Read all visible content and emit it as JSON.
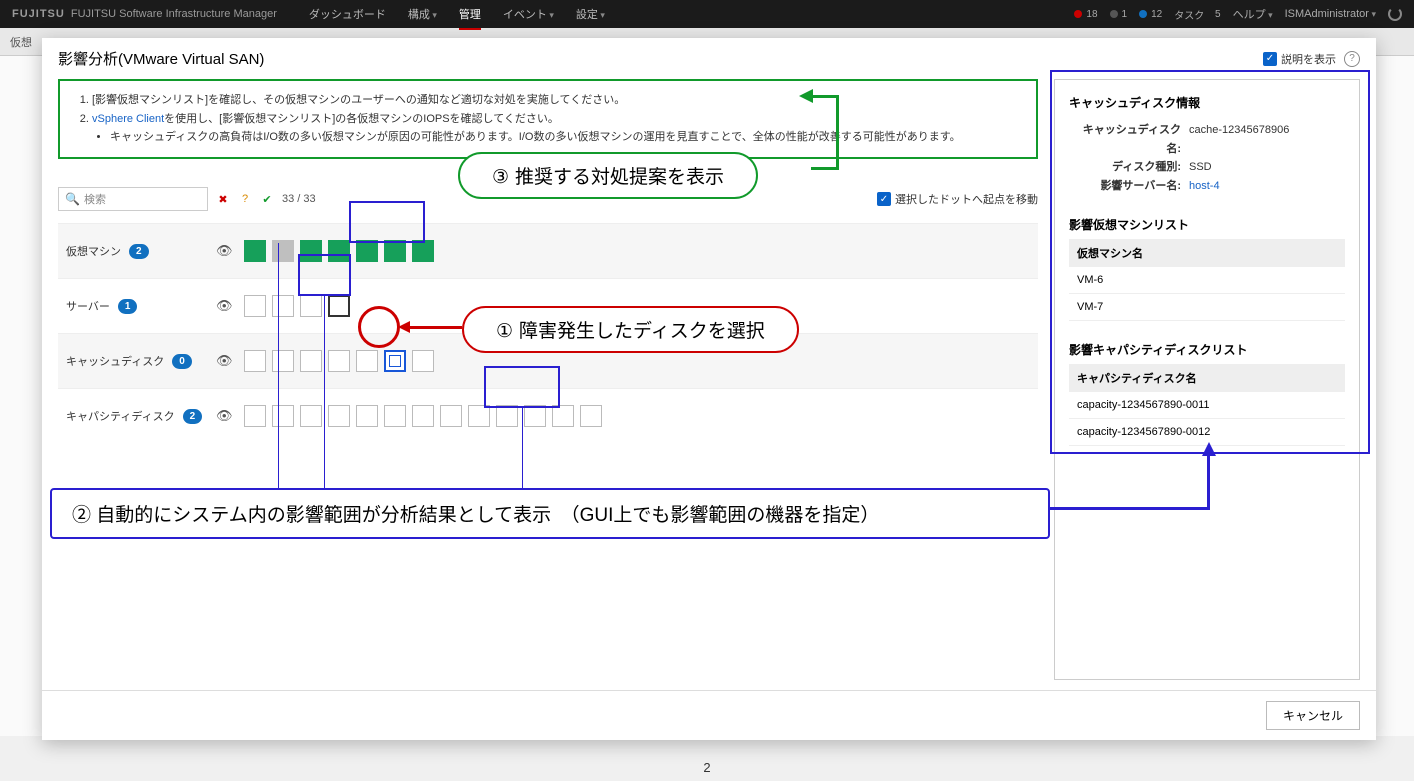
{
  "topbar": {
    "brand": "FUJITSU",
    "product": "FUJITSU Software Infrastructure Manager",
    "menu": {
      "dashboard": "ダッシュボード",
      "structure": "構成",
      "manage": "管理",
      "event": "イベント",
      "settings": "設定"
    },
    "alerts": {
      "red": "18",
      "gray": "1",
      "blue": "12"
    },
    "tasks_label": "タスク",
    "tasks_count": "5",
    "help": "ヘルプ",
    "user": "ISMAdministrator"
  },
  "subbar": {
    "tab": "仮想"
  },
  "modal": {
    "title": "影響分析(VMware Virtual SAN)",
    "show_desc": "説明を表示",
    "advisory": {
      "line1": "[影響仮想マシンリスト]を確認し、その仮想マシンのユーザーへの通知など適切な対処を実施してください。",
      "line2a": "vSphere Client",
      "line2b": "を使用し、[影響仮想マシンリスト]の各仮想マシンのIOPSを確認してください。",
      "bullet": "キャッシュディスクの高負荷はI/O数の多い仮想マシンが原因の可能性があります。I/O数の多い仮想マシンの運用を見直すことで、全体の性能が改善する可能性があります。"
    },
    "filter": {
      "placeholder": "検索",
      "count": "33 / 33",
      "move_origin": "選択したドットへ起点を移動"
    },
    "lanes": {
      "vm": {
        "label": "仮想マシン",
        "badge": "2"
      },
      "server": {
        "label": "サーバー",
        "badge": "1"
      },
      "cache": {
        "label": "キャッシュディスク",
        "badge": "0"
      },
      "capacity": {
        "label": "キャパシティディスク",
        "badge": "2"
      }
    },
    "cancel": "キャンセル"
  },
  "detail": {
    "header": "キャッシュディスク情報",
    "labels": {
      "name": "キャッシュディスク名:",
      "type": "ディスク種別:",
      "server": "影響サーバー名:"
    },
    "values": {
      "name": "cache-12345678906",
      "type": "SSD",
      "server": "host-4"
    },
    "vm_section": "影響仮想マシンリスト",
    "vm_col": "仮想マシン名",
    "vms": [
      "VM-6",
      "VM-7"
    ],
    "cap_section": "影響キャパシティディスクリスト",
    "cap_col": "キャパシティディスク名",
    "caps": [
      "capacity-1234567890-0011",
      "capacity-1234567890-0012"
    ]
  },
  "annotations": {
    "step1": "① 障害発生したディスクを選択",
    "step2": "② 自動的にシステム内の影響範囲が分析結果として表示　（GUI上でも影響範囲の機器を指定）",
    "step3": "③ 推奨する対処提案を表示"
  },
  "page_number": "2"
}
